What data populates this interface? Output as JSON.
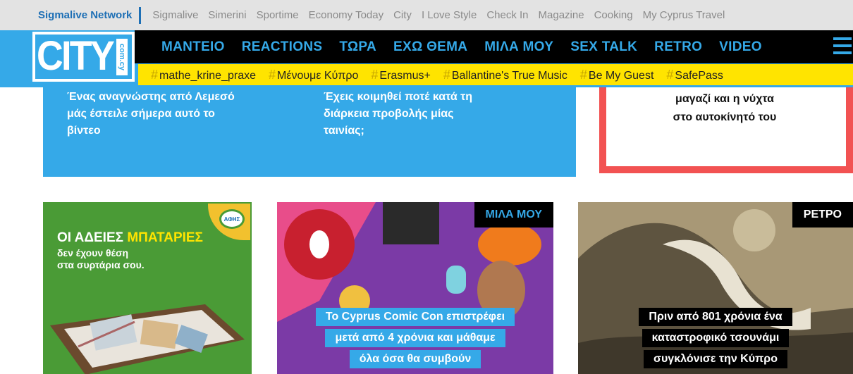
{
  "network": {
    "brand": "Sigmalive Network",
    "links": [
      "Sigmalive",
      "Simerini",
      "Sportime",
      "Economy Today",
      "City",
      "I Love Style",
      "Check In",
      "Magazine",
      "Cooking",
      "My Cyprus Travel"
    ]
  },
  "logo": {
    "main": "CITY",
    "tag": "com.cy"
  },
  "main_nav": [
    "ΜΑΝΤΕΙΟ",
    "REACTIONS",
    "ΤΩΡΑ",
    "ΕΧΩ ΘΕΜΑ",
    "ΜΙΛΑ ΜΟΥ",
    "SEX TALK",
    "RETRO",
    "VIDEO"
  ],
  "tags": [
    "mathe_krine_praxe",
    "Μένουμε Κύπρο",
    "Erasmus+",
    "Ballantine's True Music",
    "Be My Guest",
    "SafePass"
  ],
  "top_articles": {
    "left": [
      "Ένας αναγνώστης από Λεμεσό",
      "μάς έστειλε σήμερα αυτό το",
      "βίντεο"
    ],
    "middle": [
      "Έχεις κοιμηθεί ποτέ κατά τη",
      "διάρκεια προβολής μίας",
      "ταινίας;"
    ],
    "right": [
      "μαγαζί και η νύχτα",
      "στο αυτοκίνητό του"
    ]
  },
  "ad_card": {
    "title_white": "ΟΙ ΑΔΕΙΕΣ ",
    "title_yellow": "ΜΠΑΤΑΡΙΕΣ",
    "sub": [
      "δεν έχουν θέση",
      "στα συρτάρια σου."
    ],
    "badge": "ΑΦΗΣ"
  },
  "comic_card": {
    "category": "ΜΙΛΑ ΜΟΥ",
    "caption": [
      "Το Cyprus Comic Con επιστρέφει",
      "μετά από 4 χρόνια και μάθαμε",
      "όλα όσα θα συμβούν"
    ]
  },
  "wave_card": {
    "category": "ΡΕΤΡΟ",
    "caption": [
      "Πριν από 801 χρόνια ένα",
      "καταστροφικό τσουνάμι",
      "συγκλόνισε την Κύπρο"
    ]
  },
  "colors": {
    "brand_blue": "#35a9e8",
    "yellow": "#ffe400",
    "red_border": "#f25252",
    "network_blue": "#1d6fb5"
  },
  "icons": {
    "menu": "hamburger-menu-icon",
    "tag": "hashtag-icon"
  }
}
